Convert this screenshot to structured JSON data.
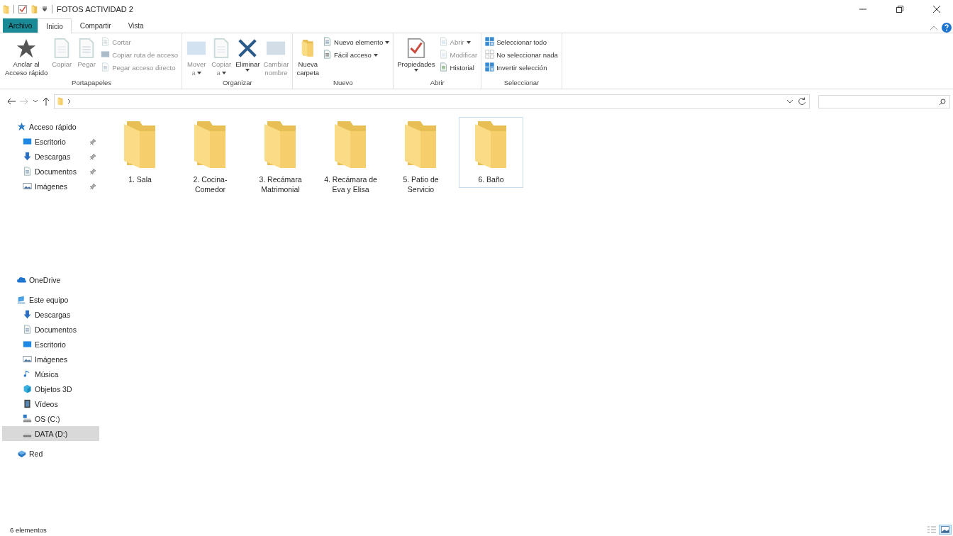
{
  "window": {
    "title": "FOTOS ACTIVIDAD 2"
  },
  "tabs": [
    {
      "label": "Archivo",
      "kind": "file",
      "selected": false
    },
    {
      "label": "Inicio",
      "kind": "tab",
      "selected": true
    },
    {
      "label": "Compartir",
      "kind": "tab",
      "selected": false
    },
    {
      "label": "Vista",
      "kind": "tab",
      "selected": false
    }
  ],
  "ribbon": {
    "groups": [
      {
        "label": "Portapapeles",
        "items": [
          {
            "kind": "large",
            "lines": [
              "Anclar al",
              "Acceso rápido"
            ],
            "disabled": false,
            "dropdown": false
          },
          {
            "kind": "large",
            "lines": [
              "Copiar"
            ],
            "disabled": true,
            "dropdown": false
          },
          {
            "kind": "large",
            "lines": [
              "Pegar"
            ],
            "disabled": true,
            "dropdown": false
          },
          {
            "kind": "small",
            "lines": [
              "Cortar"
            ],
            "disabled": true,
            "dropdown": false
          },
          {
            "kind": "small",
            "lines": [
              "Copiar ruta de acceso"
            ],
            "disabled": true,
            "dropdown": false
          },
          {
            "kind": "small",
            "lines": [
              "Pegar acceso directo"
            ],
            "disabled": true,
            "dropdown": false
          }
        ]
      },
      {
        "label": "Organizar",
        "items": [
          {
            "kind": "large",
            "lines": [
              "Mover",
              "a"
            ],
            "disabled": true,
            "dropdown": true
          },
          {
            "kind": "large",
            "lines": [
              "Copiar",
              "a"
            ],
            "disabled": true,
            "dropdown": true
          },
          {
            "kind": "large",
            "lines": [
              "Eliminar"
            ],
            "disabled": false,
            "dropdown": true
          },
          {
            "kind": "large",
            "lines": [
              "Cambiar",
              "nombre"
            ],
            "disabled": true,
            "dropdown": false
          }
        ]
      },
      {
        "label": "Nuevo",
        "items": [
          {
            "kind": "large",
            "lines": [
              "Nueva",
              "carpeta"
            ],
            "disabled": false,
            "dropdown": false
          },
          {
            "kind": "small",
            "lines": [
              "Nuevo elemento"
            ],
            "disabled": false,
            "dropdown": true
          },
          {
            "kind": "small",
            "lines": [
              "Fácil acceso"
            ],
            "disabled": false,
            "dropdown": true
          }
        ]
      },
      {
        "label": "Abrir",
        "items": [
          {
            "kind": "large",
            "lines": [
              "Propiedades"
            ],
            "disabled": false,
            "dropdown": true
          },
          {
            "kind": "small",
            "lines": [
              "Abrir"
            ],
            "disabled": true,
            "dropdown": true
          },
          {
            "kind": "small",
            "lines": [
              "Modificar"
            ],
            "disabled": true,
            "dropdown": false
          },
          {
            "kind": "small",
            "lines": [
              "Historial"
            ],
            "disabled": false,
            "dropdown": false
          }
        ]
      },
      {
        "label": "Seleccionar",
        "items": [
          {
            "kind": "small",
            "lines": [
              "Seleccionar todo"
            ],
            "disabled": false,
            "dropdown": false
          },
          {
            "kind": "small",
            "lines": [
              "No seleccionar nada"
            ],
            "disabled": false,
            "dropdown": false
          },
          {
            "kind": "small",
            "lines": [
              "Invertir selección"
            ],
            "disabled": false,
            "dropdown": false
          }
        ]
      }
    ]
  },
  "sidebar": {
    "items": [
      {
        "label": "Acceso rápido",
        "selected": false,
        "children": [
          {
            "label": "Escritorio",
            "selected": false,
            "pinned": true
          },
          {
            "label": "Descargas",
            "selected": false,
            "pinned": true
          },
          {
            "label": "Documentos",
            "selected": false,
            "pinned": true
          },
          {
            "label": "Imágenes",
            "selected": false,
            "pinned": true
          }
        ]
      },
      {
        "label": "OneDrive",
        "selected": false
      },
      {
        "label": "Este equipo",
        "selected": false,
        "children": [
          {
            "label": "Descargas",
            "selected": false
          },
          {
            "label": "Documentos",
            "selected": false
          },
          {
            "label": "Escritorio",
            "selected": false
          },
          {
            "label": "Imágenes",
            "selected": false
          },
          {
            "label": "Música",
            "selected": false
          },
          {
            "label": "Objetos 3D",
            "selected": false
          },
          {
            "label": "Vídeos",
            "selected": false
          },
          {
            "label": "OS (C:)",
            "selected": false
          },
          {
            "label": "DATA (D:)",
            "selected": true
          }
        ]
      },
      {
        "label": "Red",
        "selected": false
      }
    ]
  },
  "files": [
    {
      "name": "1. Sala",
      "selected": false
    },
    {
      "name": "2. Cocina-Comedor",
      "selected": false
    },
    {
      "name": "3. Recámara Matrimonial",
      "selected": false
    },
    {
      "name": "4. Recámara de Eva y Elisa",
      "selected": false
    },
    {
      "name": "5. Patio de Servicio",
      "selected": false
    },
    {
      "name": "6. Baño",
      "selected": true
    }
  ],
  "status_bar": {
    "text": "6 elementos",
    "views": [
      {
        "selected": false
      },
      {
        "selected": true
      }
    ]
  }
}
